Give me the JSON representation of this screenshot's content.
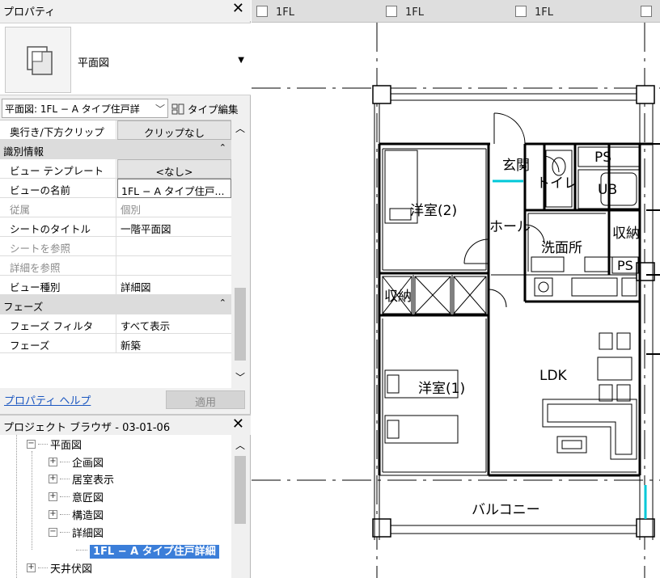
{
  "properties_panel": {
    "title": "プロパティ",
    "close": "✕",
    "type_name": "平面図",
    "view_selector": "平面図: 1FL − A タイプ住戸詳",
    "edit_type": "タイプ編集",
    "rows": [
      {
        "label": "奥行き/下方クリップ",
        "value": "クリップなし",
        "kind": "btn"
      },
      {
        "label": "識別情報",
        "kind": "section"
      },
      {
        "label": "ビュー テンプレート",
        "value": "<なし>",
        "kind": "btn"
      },
      {
        "label": "ビューの名前",
        "value": "1FL − A タイプ住戸...",
        "kind": "boxed"
      },
      {
        "label": "従属",
        "value": "個別",
        "kind": "grey"
      },
      {
        "label": "シートのタイトル",
        "value": "一階平面図",
        "kind": "normal"
      },
      {
        "label": "シートを参照",
        "value": "",
        "kind": "grey"
      },
      {
        "label": "詳細を参照",
        "value": "",
        "kind": "grey"
      },
      {
        "label": "ビュー種別",
        "value": "詳細図",
        "kind": "normal"
      },
      {
        "label": "フェーズ",
        "kind": "section"
      },
      {
        "label": "フェーズ フィルタ",
        "value": "すべて表示",
        "kind": "normal"
      },
      {
        "label": "フェーズ",
        "value": "新築",
        "kind": "normal"
      }
    ],
    "help_link": "プロパティ ヘルプ",
    "apply": "適用"
  },
  "project_browser": {
    "title": "プロジェクト ブラウザ - 03-01-06",
    "close": "✕",
    "tree": {
      "root": "平面図",
      "children": [
        "企画図",
        "居室表示",
        "意匠図",
        "構造図",
        "詳細図"
      ],
      "selected": "1FL − A タイプ住戸詳細",
      "next": "天井伏図"
    }
  },
  "view_tabs": [
    "1FL",
    "1FL",
    "1FL"
  ],
  "plan": {
    "rooms": {
      "genkan": "玄関",
      "toilet": "トイレ",
      "ps": "PS",
      "ub": "UB",
      "western2": "洋室(2)",
      "hall": "ホール",
      "senmen": "洗面所",
      "shuno": "収納",
      "shuno_right": "収納",
      "ps2": "PS",
      "western1": "洋室(1)",
      "ldk": "LDK",
      "balcony": "バルコニー"
    }
  }
}
